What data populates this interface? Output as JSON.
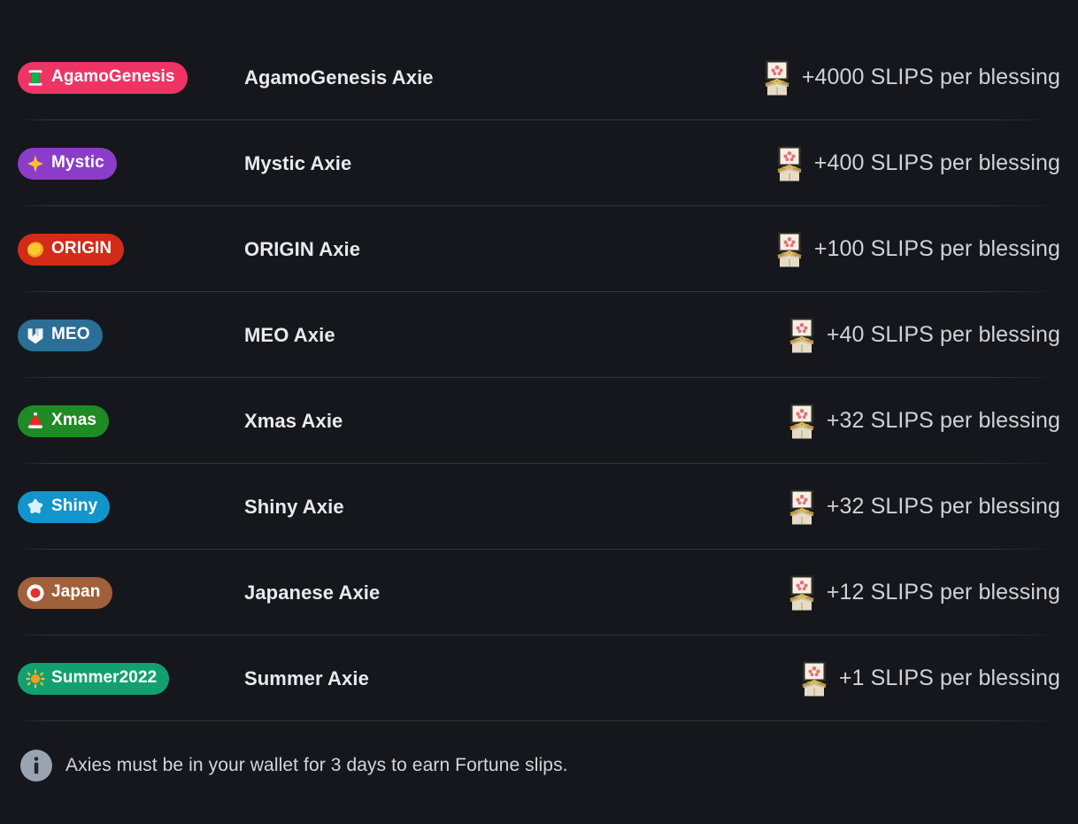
{
  "theme": {
    "background": "#15171c",
    "divider": "rgba(255,255,255,0.13)",
    "name_text": "#e8eaee",
    "reward_text": "#ced2d9",
    "note_text": "#d2d6dd"
  },
  "icons": {
    "reward": "fortune-slip-icon",
    "note": "info-icon"
  },
  "rows": [
    {
      "badge_label": "AgamoGenesis",
      "badge_color": "#EE3465",
      "badge_icon": "thread-spool-icon",
      "name": "AgamoGenesis Axie",
      "reward": "+4000 SLIPS per blessing",
      "reward_amount": 4000
    },
    {
      "badge_label": "Mystic",
      "badge_color": "#8B3CC8",
      "badge_icon": "sparkle-icon",
      "name": "Mystic Axie",
      "reward": "+400 SLIPS per blessing",
      "reward_amount": 400
    },
    {
      "badge_label": "ORIGIN",
      "badge_color": "#D42A18",
      "badge_icon": "gold-coin-icon",
      "name": "ORIGIN Axie",
      "reward": "+100 SLIPS per blessing",
      "reward_amount": 100
    },
    {
      "badge_label": "MEO",
      "badge_color": "#2B6E96",
      "badge_icon": "meo-m-logo-icon",
      "name": "MEO Axie",
      "reward": "+40 SLIPS per blessing",
      "reward_amount": 40
    },
    {
      "badge_label": "Xmas",
      "badge_color": "#1F8A26",
      "badge_icon": "santa-hat-icon",
      "name": "Xmas Axie",
      "reward": "+32 SLIPS per blessing",
      "reward_amount": 32
    },
    {
      "badge_label": "Shiny",
      "badge_color": "#1294CC",
      "badge_icon": "star-icon",
      "name": "Shiny Axie",
      "reward": "+32 SLIPS per blessing",
      "reward_amount": 32
    },
    {
      "badge_label": "Japan",
      "badge_color": "#A0603A",
      "badge_icon": "japan-flag-icon",
      "name": "Japanese Axie",
      "reward": "+12 SLIPS per blessing",
      "reward_amount": 12
    },
    {
      "badge_label": "Summer2022",
      "badge_color": "#12A071",
      "badge_icon": "sun-icon",
      "name": "Summer Axie",
      "reward": "+1 SLIPS per blessing",
      "reward_amount": 1
    }
  ],
  "note": {
    "text": "Axies must be in your wallet for 3 days to earn Fortune slips."
  }
}
